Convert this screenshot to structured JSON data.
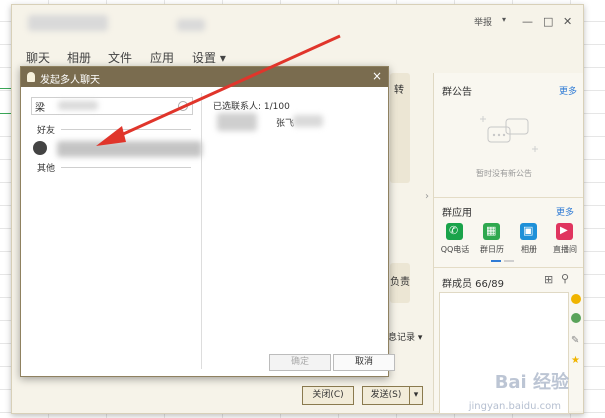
{
  "window": {
    "title_right": "举报",
    "minimize": "—",
    "maximize": "□",
    "close": "✕"
  },
  "menu": [
    "聊天",
    "相册",
    "文件",
    "应用",
    "设置 ▾"
  ],
  "dialog": {
    "title": "发起多人聊天",
    "close": "×",
    "search_value": "梁",
    "group_friends": "好友",
    "group_other": "其他",
    "selected_label": "已选联系人: 1/100",
    "selected_name": "张飞",
    "confirm": "确定",
    "cancel": "取消"
  },
  "side_fragments": {
    "top": "转",
    "mid": "负责",
    "msg_record": "息记录 ▾",
    "toggle": "›"
  },
  "right_panel": {
    "notice_title": "群公告",
    "notice_more": "更多",
    "notice_empty": "暂时没有新公告",
    "apps_title": "群应用",
    "apps_more": "更多",
    "apps": [
      {
        "label": "QQ电话",
        "color": "#1aa34a",
        "glyph": "✆"
      },
      {
        "label": "群日历",
        "color": "#2fa84f",
        "glyph": "▦"
      },
      {
        "label": "相册",
        "color": "#1e90d8",
        "glyph": "▣"
      },
      {
        "label": "直播间",
        "color": "#e0355f",
        "glyph": "▶"
      }
    ],
    "members_title": "群成员 66/89"
  },
  "bottom": {
    "close_btn": "关闭(C)",
    "send_btn": "发送(S)",
    "send_arrow": "▾"
  },
  "watermark": {
    "brand": "Bai 经验",
    "url": "jingyan.baidu.com"
  },
  "colors": {
    "dialog_titlebar": "#7a6c4f",
    "arrow": "#e0352b",
    "link": "#2f7bd5"
  }
}
